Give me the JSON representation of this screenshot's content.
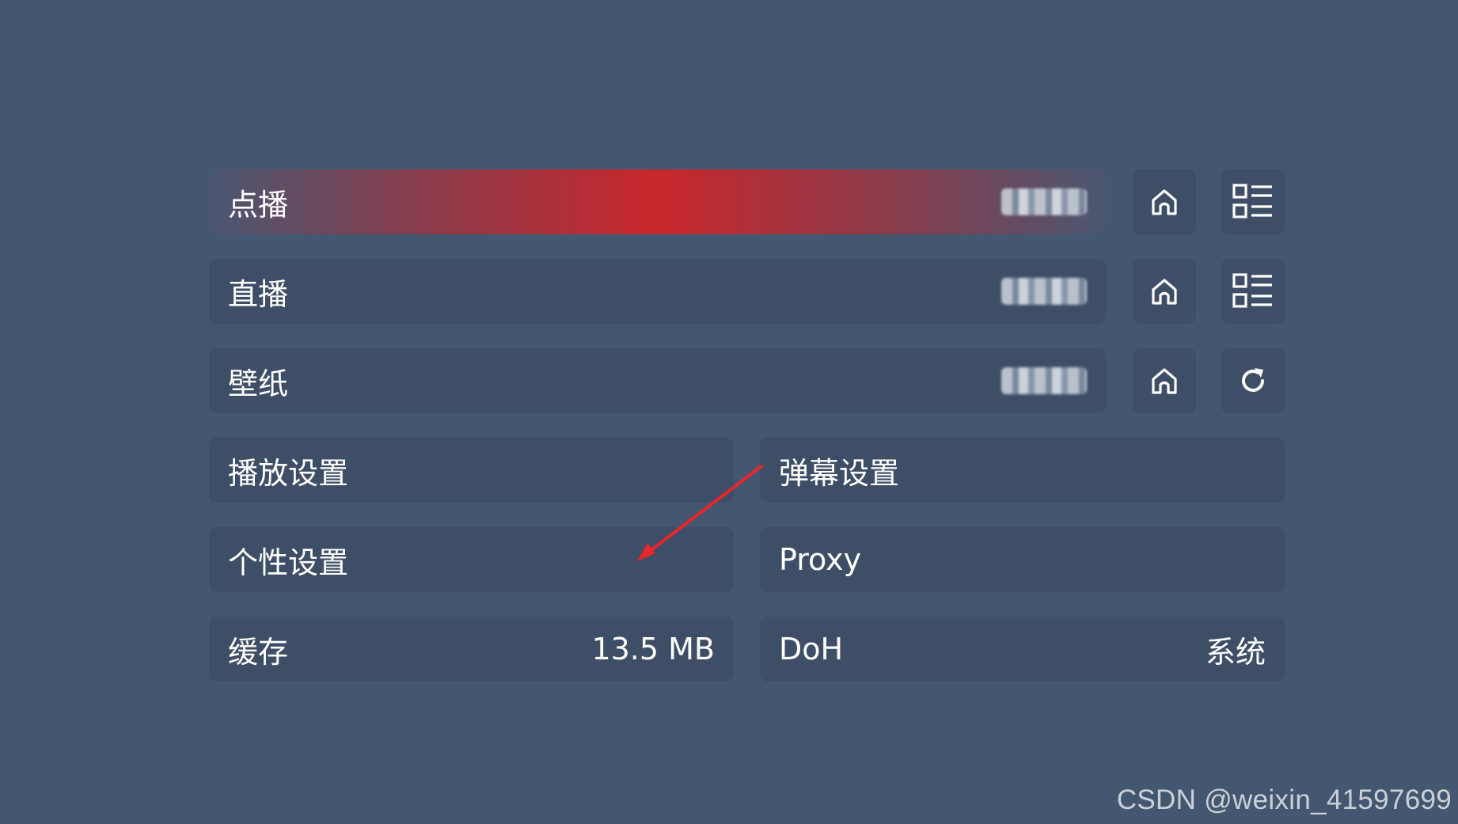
{
  "settings": {
    "vod": {
      "label": "点播",
      "value": ""
    },
    "live": {
      "label": "直播",
      "value": ""
    },
    "wallpaper": {
      "label": "壁纸",
      "value": ""
    },
    "player_settings": {
      "label": "播放设置"
    },
    "danmaku_settings": {
      "label": "弹幕设置"
    },
    "personal_settings": {
      "label": "个性设置"
    },
    "proxy": {
      "label": "Proxy"
    },
    "cache": {
      "label": "缓存",
      "value": "13.5 MB"
    },
    "doh": {
      "label": "DoH",
      "value": "系统"
    }
  },
  "icons": {
    "home": "home-icon",
    "list": "grid-list-icon",
    "refresh": "refresh-icon"
  },
  "colors": {
    "background": "#445770",
    "row": "#3d4e66",
    "focus_accent": "#c8272b",
    "annotation_arrow": "#e8262b"
  },
  "watermark": "CSDN @weixin_41597699"
}
